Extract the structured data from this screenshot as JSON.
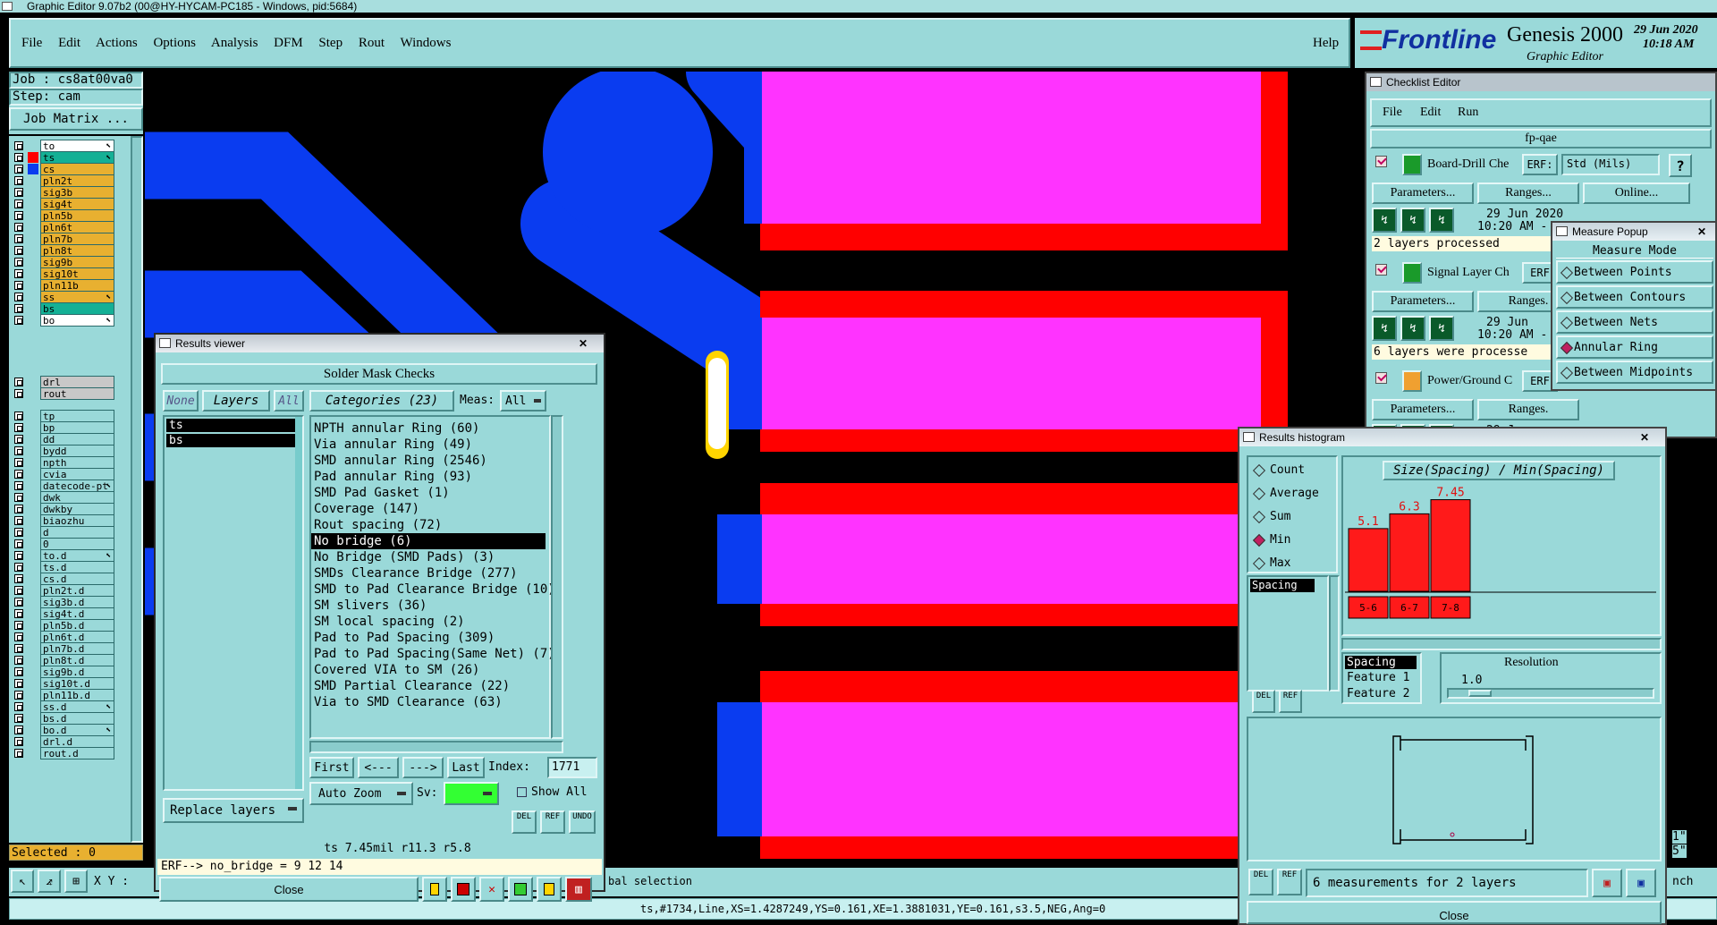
{
  "app": {
    "window_title": "Graphic Editor 9.07b2 (00@HY-HYCAM-PC185 - Windows, pid:5684)",
    "menu": [
      "File",
      "Edit",
      "Actions",
      "Options",
      "Analysis",
      "DFM",
      "Step",
      "Rout",
      "Windows"
    ],
    "help": "Help",
    "brand": "Frontline",
    "product": "Genesis 2000",
    "product_sub": "Graphic Editor",
    "date": "29 Jun 2020",
    "time": "10:18 AM",
    "job_label": "Job : cs8at00va0",
    "step_label": "Step: cam",
    "job_matrix": "Job Matrix ...",
    "selected": "Selected : 0",
    "xy_label": "X Y :",
    "status_line": "ts,#1734,Line,XS=1.4287249,YS=0.161,XE=1.3881031,YE=0.161,s3.5,NEG,Ang=0",
    "selection_text": "bal selection",
    "right_edge_1": "1\"",
    "right_edge_2": "5\"",
    "right_edge_3": "nch"
  },
  "layers": [
    {
      "name": "to",
      "color": "#ffffff",
      "swatch": "",
      "arrow": "⬉"
    },
    {
      "name": "ts",
      "color": "#14b095",
      "swatch": "#ff0000",
      "arrow": "⬉"
    },
    {
      "name": "cs",
      "color": "#e8b030",
      "swatch": "#0a3cf0",
      "arrow": ""
    },
    {
      "name": "pln2t",
      "color": "#e8b030",
      "swatch": "",
      "arrow": ""
    },
    {
      "name": "sig3b",
      "color": "#e8b030",
      "swatch": "",
      "arrow": ""
    },
    {
      "name": "sig4t",
      "color": "#e8b030",
      "swatch": "",
      "arrow": ""
    },
    {
      "name": "pln5b",
      "color": "#e8b030",
      "swatch": "",
      "arrow": ""
    },
    {
      "name": "pln6t",
      "color": "#e8b030",
      "swatch": "",
      "arrow": ""
    },
    {
      "name": "pln7b",
      "color": "#e8b030",
      "swatch": "",
      "arrow": ""
    },
    {
      "name": "pln8t",
      "color": "#e8b030",
      "swatch": "",
      "arrow": ""
    },
    {
      "name": "sig9b",
      "color": "#e8b030",
      "swatch": "",
      "arrow": ""
    },
    {
      "name": "sig10t",
      "color": "#e8b030",
      "swatch": "",
      "arrow": ""
    },
    {
      "name": "pln11b",
      "color": "#e8b030",
      "swatch": "",
      "arrow": ""
    },
    {
      "name": "ss",
      "color": "#e8b030",
      "swatch": "",
      "arrow": "⬉"
    },
    {
      "name": "bs",
      "color": "#14b095",
      "swatch": "",
      "arrow": ""
    },
    {
      "name": "bo",
      "color": "#ffffff",
      "swatch": "",
      "arrow": "⬉"
    }
  ],
  "layers2": [
    {
      "name": "drl",
      "color": "#c8c8c8",
      "arrow": ""
    },
    {
      "name": "rout",
      "color": "#c8c8c8",
      "arrow": ""
    }
  ],
  "layers3": [
    {
      "name": "tp",
      "arrow": ""
    },
    {
      "name": "bp",
      "arrow": ""
    },
    {
      "name": "dd",
      "arrow": ""
    },
    {
      "name": "bydd",
      "arrow": ""
    },
    {
      "name": "npth",
      "arrow": ""
    },
    {
      "name": "cvia",
      "arrow": ""
    },
    {
      "name": "datecode-pt",
      "arrow": "⬉"
    },
    {
      "name": "dwk",
      "arrow": ""
    },
    {
      "name": "dwkby",
      "arrow": ""
    },
    {
      "name": "biaozhu",
      "arrow": ""
    },
    {
      "name": "d",
      "arrow": ""
    },
    {
      "name": "0",
      "arrow": ""
    },
    {
      "name": "to.d",
      "arrow": "⬉"
    },
    {
      "name": "ts.d",
      "arrow": ""
    },
    {
      "name": "cs.d",
      "arrow": ""
    },
    {
      "name": "pln2t.d",
      "arrow": ""
    },
    {
      "name": "sig3b.d",
      "arrow": ""
    },
    {
      "name": "sig4t.d",
      "arrow": ""
    },
    {
      "name": "pln5b.d",
      "arrow": ""
    },
    {
      "name": "pln6t.d",
      "arrow": ""
    },
    {
      "name": "pln7b.d",
      "arrow": ""
    },
    {
      "name": "pln8t.d",
      "arrow": ""
    },
    {
      "name": "sig9b.d",
      "arrow": ""
    },
    {
      "name": "sig10t.d",
      "arrow": ""
    },
    {
      "name": "pln11b.d",
      "arrow": ""
    },
    {
      "name": "ss.d",
      "arrow": "⬉"
    },
    {
      "name": "bs.d",
      "arrow": ""
    },
    {
      "name": "bo.d",
      "arrow": "⬉"
    },
    {
      "name": "drl.d",
      "arrow": ""
    },
    {
      "name": "rout.d",
      "arrow": ""
    }
  ],
  "results_viewer": {
    "title": "Results viewer",
    "header": "Solder Mask Checks",
    "none": "None",
    "layers": "Layers",
    "all": "All",
    "categories_btn": "Categories (23)",
    "meas_label": "Meas:",
    "meas_value": "All",
    "layer_items": [
      "ts",
      "bs"
    ],
    "categories": [
      "NPTH annular Ring (60)",
      "Via annular Ring (49)",
      "SMD annular Ring (2546)",
      "Pad annular Ring (93)",
      "SMD Pad Gasket (1)",
      "Coverage (147)",
      "Rout spacing (72)",
      "No bridge (6)",
      "No Bridge (SMD Pads) (3)",
      "SMDs Clearance Bridge (277)",
      "SMD to Pad Clearance Bridge (10)",
      "SM slivers (36)",
      "SM local spacing (2)",
      "Pad to Pad Spacing (309)",
      "Pad to Pad Spacing(Same Net) (7)",
      "Covered VIA to SM (26)",
      "SMD Partial Clearance (22)",
      "Via to SMD Clearance (63)"
    ],
    "selected_index": 7,
    "first": "First",
    "prev": "<---",
    "next": "--->",
    "last": "Last",
    "index_label": "Index:",
    "index_value": "1771",
    "auto_zoom": "Auto Zoom",
    "sv_label": "Sv:",
    "show_all": "Show All",
    "replace_layers": "Replace layers",
    "del": "DEL",
    "ref": "REF",
    "undo": "UNDO",
    "info": "ts 7.45mil  r11.3  r5.8",
    "erf": "ERF--> no_bridge = 9 12 14",
    "close": "Close"
  },
  "checklist": {
    "title": "Checklist Editor",
    "menu": [
      "File",
      "Edit",
      "Run"
    ],
    "name": "fp-qae",
    "erf": "ERF:",
    "std": "Std (Mils)",
    "q": "?",
    "checks": [
      {
        "name": "Board-Drill Che",
        "params": "Parameters...",
        "ranges": "Ranges...",
        "online": "Online...",
        "date": "29 Jun 2020",
        "time": "10:20 AM -",
        "status": "2 layers processed"
      },
      {
        "name": "Signal Layer Ch",
        "params": "Parameters...",
        "ranges": "Ranges.",
        "date": "29 Jun",
        "time": "10:20 AM -",
        "status": "6 layers were processe"
      },
      {
        "name": "Power/Ground C",
        "params": "Parameters...",
        "ranges": "Ranges.",
        "date": "29 Jun",
        "time": "",
        "status": ""
      }
    ],
    "erf_short": "ERF"
  },
  "measure": {
    "title": "Measure Popup",
    "header": "Measure Mode",
    "modes": [
      "Between Points",
      "Between Contours",
      "Between Nets",
      "Annular Ring",
      "Between Midpoints"
    ],
    "selected": 3
  },
  "histogram": {
    "title": "Results histogram",
    "options": [
      "Count",
      "Average",
      "Sum",
      "Min",
      "Max"
    ],
    "selected": 3,
    "list_item": "Spacing",
    "chart_title": "Size(Spacing) / Min(Spacing)",
    "fields": [
      "Spacing",
      "Feature 1",
      "Feature 2"
    ],
    "resolution_label": "Resolution",
    "resolution_value": "1.0",
    "del": "DEL",
    "ref": "REF",
    "summary": "6 measurements for 2 layers",
    "close": "Close"
  },
  "chart_data": {
    "type": "bar",
    "title": "Size(Spacing) / Min(Spacing)",
    "categories": [
      "5-6",
      "6-7",
      "7-8"
    ],
    "values": [
      5.1,
      6.3,
      7.45
    ],
    "color": "#ff1a1a"
  }
}
